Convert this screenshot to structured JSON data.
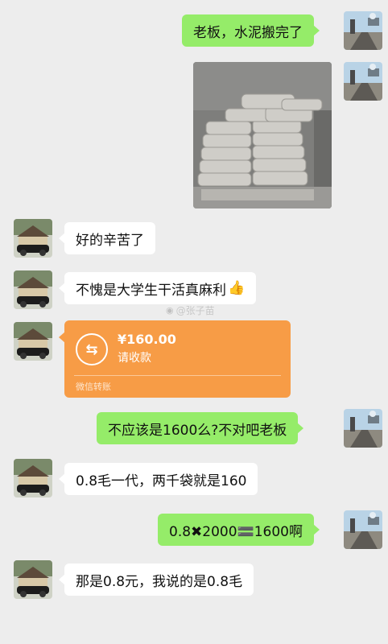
{
  "messages": {
    "m1": "老板，水泥搬完了",
    "m2": "好的辛苦了",
    "m3": "不愧是大学生干活真麻利",
    "m4": "不应该是1600么?不对吧老板",
    "m5": "0.8毛一代，两千袋就是160",
    "m6": "0.8✖2000🟰1600啊",
    "m7": "那是0.8元，我说的是0.8毛"
  },
  "thumbs_emoji": "👍",
  "transfer": {
    "icon_glyph": "⇆",
    "amount": "¥160.00",
    "status": "请收款",
    "footer": "微信转账"
  },
  "watermark": {
    "platform_glyph": "◉",
    "handle": "@张子苗"
  },
  "colors": {
    "background": "#ededed",
    "my_bubble": "#95ec69",
    "their_bubble": "#ffffff",
    "transfer": "#f79c46"
  },
  "icons": {
    "my_avatar": "road-landscape-avatar",
    "boss_avatar": "car-house-avatar",
    "photo": "cement-bags-photo"
  }
}
